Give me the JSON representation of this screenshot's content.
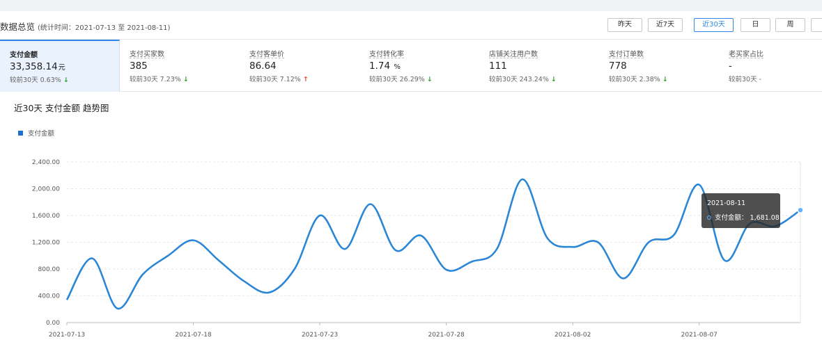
{
  "header": {
    "title": "数据总览",
    "subtitle": "(统计时间：2021-07-13 至 2021-08-11)",
    "buttons": [
      "昨天",
      "近7天",
      "近30天",
      "日",
      "周"
    ],
    "active_button": "近30天"
  },
  "cards": [
    {
      "label": "支付金额",
      "value": "33,358.14",
      "unit": "元",
      "compare_text": "较前30天 0.63%",
      "trend": "down"
    },
    {
      "label": "支付买家数",
      "value": "385",
      "unit": "",
      "compare_text": "较前30天 7.23%",
      "trend": "down"
    },
    {
      "label": "支付客单价",
      "value": "86.64",
      "unit": "",
      "compare_text": "较前30天 7.12%",
      "trend": "up"
    },
    {
      "label": "支付转化率",
      "value": "1.74",
      "unit": "%",
      "compare_text": "较前30天 26.29%",
      "trend": "down"
    },
    {
      "label": "店铺关注用户数",
      "value": "111",
      "unit": "",
      "compare_text": "较前30天 243.24%",
      "trend": "down"
    },
    {
      "label": "支付订单数",
      "value": "778",
      "unit": "",
      "compare_text": "较前30天 2.38%",
      "trend": "down"
    },
    {
      "label": "老买家占比",
      "value": "-",
      "unit": "",
      "compare_text": "较前30天 -",
      "trend": ""
    }
  ],
  "chart_title": "近30天 支付金额 趋势图",
  "tooltip": {
    "date": "2021-08-11",
    "label": "支付金额：",
    "value": "1,681.08"
  },
  "colors": {
    "accent": "#2f88e4",
    "line": "#2b86d6",
    "down": "#2ca02c",
    "up": "#e8483b"
  },
  "icons": {
    "down": "arrow-down-icon",
    "up": "arrow-up-icon"
  },
  "chart_data": {
    "type": "line",
    "title": "近30天 支付金额 趋势图",
    "legend": "支付金额",
    "legend_position": "top-left",
    "grid": true,
    "xlabel": "",
    "ylabel": "",
    "ylim": [
      0,
      2400
    ],
    "yticks": [
      "0.00",
      "400.00",
      "800.00",
      "1,200.00",
      "1,600.00",
      "2,000.00",
      "2,400.00"
    ],
    "xtick_labels": [
      "2021-07-13",
      "2021-07-18",
      "2021-07-23",
      "2021-07-28",
      "2021-08-02",
      "2021-08-07"
    ],
    "x": [
      "2021-07-13",
      "2021-07-14",
      "2021-07-15",
      "2021-07-16",
      "2021-07-17",
      "2021-07-18",
      "2021-07-19",
      "2021-07-20",
      "2021-07-21",
      "2021-07-22",
      "2021-07-23",
      "2021-07-24",
      "2021-07-25",
      "2021-07-26",
      "2021-07-27",
      "2021-07-28",
      "2021-07-29",
      "2021-07-30",
      "2021-07-31",
      "2021-08-01",
      "2021-08-02",
      "2021-08-03",
      "2021-08-04",
      "2021-08-05",
      "2021-08-06",
      "2021-08-07",
      "2021-08-08",
      "2021-08-09",
      "2021-08-10",
      "2021-08-11"
    ],
    "series": [
      {
        "name": "支付金额",
        "values": [
          340,
          960,
          210,
          720,
          1000,
          1230,
          930,
          620,
          450,
          800,
          1600,
          1100,
          1770,
          1080,
          1300,
          790,
          910,
          1100,
          2140,
          1260,
          1130,
          1200,
          660,
          1200,
          1310,
          2060,
          930,
          1480,
          1440,
          1681.08
        ]
      }
    ]
  }
}
